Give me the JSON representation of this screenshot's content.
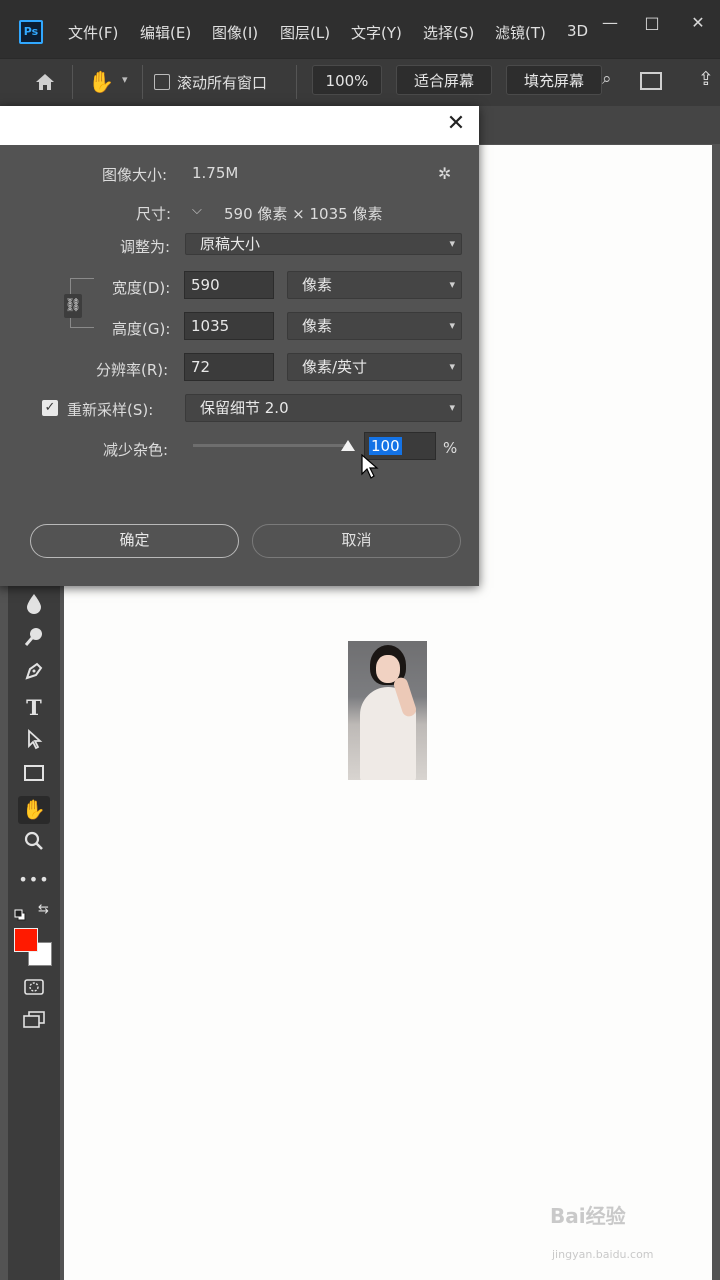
{
  "app": {
    "logo_text": "Ps"
  },
  "menu": {
    "items": [
      "文件(F)",
      "编辑(E)",
      "图像(I)",
      "图层(L)",
      "文字(Y)",
      "选择(S)",
      "滤镜(T)",
      "3D"
    ]
  },
  "window_controls": {
    "minimize": "—",
    "maximize": "□",
    "close": "✕"
  },
  "options_bar": {
    "scroll_all_label": "滚动所有窗口",
    "zoom": "100%",
    "fit_screen": "适合屏幕",
    "fill_screen": "填充屏幕"
  },
  "dialog": {
    "image_size_label": "图像大小:",
    "image_size_value": "1.75M",
    "dimensions_label": "尺寸:",
    "dimensions_value": "590 像素 × 1035 像素",
    "fit_to_label": "调整为:",
    "fit_to_value": "原稿大小",
    "width_label": "宽度(D):",
    "width_value": "590",
    "width_unit": "像素",
    "height_label": "高度(G):",
    "height_value": "1035",
    "height_unit": "像素",
    "resolution_label": "分辨率(R):",
    "resolution_value": "72",
    "resolution_unit": "像素/英寸",
    "resample_label": "重新采样(S):",
    "resample_checked": true,
    "resample_value": "保留细节 2.0",
    "noise_label": "减少杂色:",
    "noise_value": "100",
    "noise_unit": "%",
    "noise_level": 1.0,
    "ok_label": "确定",
    "cancel_label": "取消"
  },
  "colors": {
    "foreground": "#ff1a00",
    "background": "#ffffff",
    "selection": "#1473e6"
  },
  "tools": [
    "blur-icon",
    "dodge-icon",
    "pen-icon",
    "type-icon",
    "path-select-icon",
    "rectangle-icon",
    "hand-icon",
    "zoom-icon",
    "more-tools-icon"
  ],
  "watermark": {
    "brand": "Bai经验",
    "url": "jingyan.baidu.com"
  }
}
